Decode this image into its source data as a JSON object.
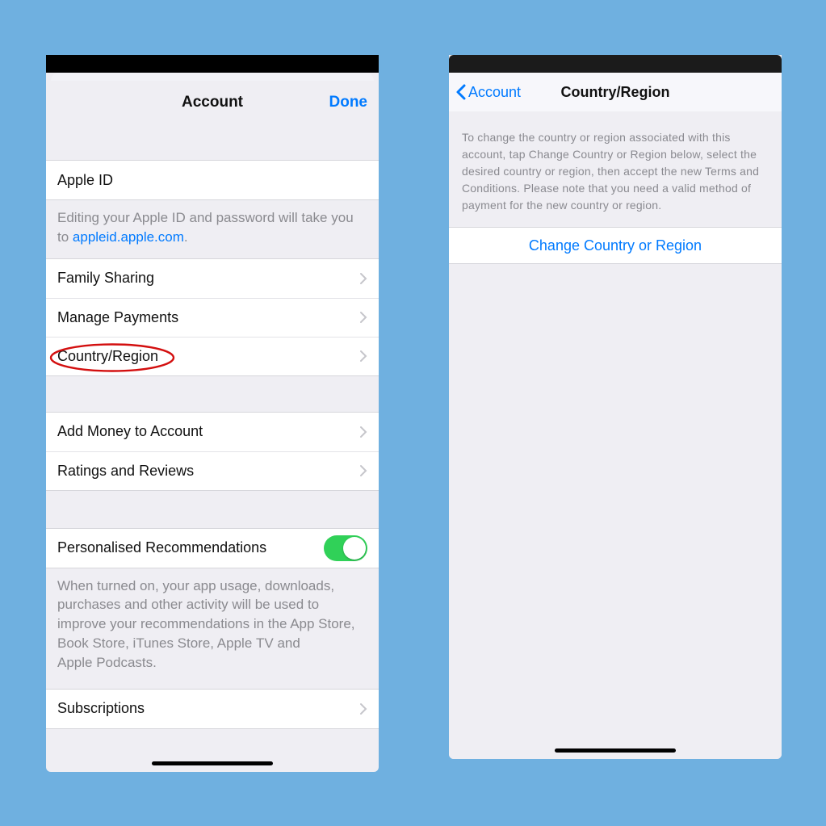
{
  "left": {
    "header": {
      "title": "Account",
      "done": "Done"
    },
    "apple_id": {
      "label": "Apple ID",
      "footer_prefix": "Editing your Apple ID and password will take you to ",
      "footer_link": "appleid.apple.com",
      "footer_suffix": "."
    },
    "items_a": [
      "Family Sharing",
      "Manage Payments",
      "Country/Region"
    ],
    "items_b": [
      "Add Money to Account",
      "Ratings and Reviews"
    ],
    "recs": {
      "label": "Personalised Recommendations",
      "footer": "When turned on, your app usage, downloads, purchases and other activity will be used to improve your recommendations in the App Store, Book Store, iTunes Store, Apple TV and Apple Podcasts."
    },
    "subs": {
      "label": "Subscriptions"
    }
  },
  "right": {
    "back": "Account",
    "title": "Country/Region",
    "instruction": "To change the country or region associated with this account, tap Change Country or Region below, select the desired country or region, then accept the new Terms and Conditions. Please note that you need a valid method of payment for the new country or region.",
    "action": "Change Country or Region"
  }
}
